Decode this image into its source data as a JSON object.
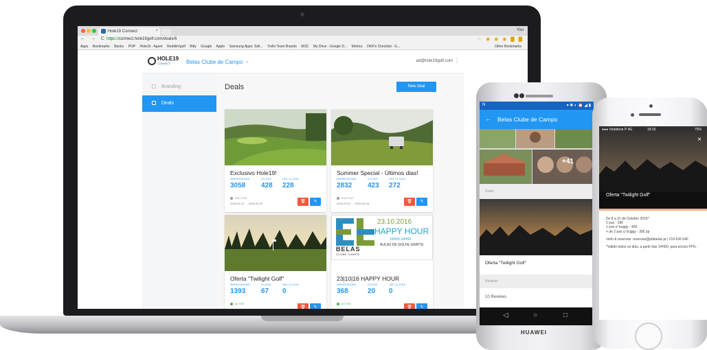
{
  "browser": {
    "tab_title": "Hole19 Connect",
    "tab_close": "×",
    "profile": "You",
    "url_scheme": "https://",
    "url_host": "connect.hole19golf.com/deals/6",
    "bookmarks": [
      "Apps",
      "Bookmarks",
      "Banks",
      "POP",
      "Hole19 - Agent",
      "Reddit/r/golf",
      "Bitly",
      "Google",
      "Apple",
      "Samsung Apps: Sell...",
      "Trello Team Boards",
      "MSC",
      "My Drive - Google D...",
      "Metrics",
      "DKR's Checklist - G..."
    ],
    "other_bookmarks": "Other Bookmarks"
  },
  "app": {
    "logo_name": "HOLE19",
    "logo_sub": "CONNECT",
    "club_name": "Belas Clube de Campo",
    "club_caret": "⌄",
    "user_email": "ad@hole19golf.com",
    "user_menu": "⋮",
    "sidebar": [
      {
        "label": "Branding",
        "active": false
      },
      {
        "label": "Deals",
        "active": true
      }
    ],
    "page_title": "Deals",
    "new_deal": "New deal",
    "metric_labels": {
      "impressions": "IMPRESSIONS",
      "clicks": "CLICKS",
      "url_clicks": "URL CLICKS"
    },
    "deals": [
      {
        "title": "Exclusivo Hole19!",
        "impressions": "3058",
        "clicks": "428",
        "url_clicks": "228",
        "status": "INACTIVE",
        "start": "2016-09-15",
        "end": "2016-09-20"
      },
      {
        "title": "Summer Special - Últimos dias!",
        "impressions": "2832",
        "clicks": "423",
        "url_clicks": "272",
        "status": "INACTIVE",
        "start": "2016-09-01",
        "end": "2016-09-16"
      },
      {
        "title": "Oferta \"Twilight Golf\"",
        "impressions": "1393",
        "clicks": "67",
        "url_clicks": "0",
        "status": "ACTIVE"
      },
      {
        "title": "23|10|16 HAPPY HOUR",
        "impressions": "368",
        "clicks": "20",
        "url_clicks": "0",
        "status": "ACTIVE"
      }
    ],
    "date_arrow": "→",
    "delete_icon": "🗑",
    "edit_icon": "✎",
    "promo": {
      "date": "23.10.2016",
      "headline": "HAPPY HOUR",
      "time": "15H00-18H00",
      "subtitle": "AULAS DE GOLFE GRÁTIS",
      "brand": "BELAS",
      "brand_sub": "CLUBE CAMPO"
    }
  },
  "android": {
    "status_left": "N",
    "status_right": "▾ ✱ ◐ ⏰ ◢ ▮",
    "title": "Belas Clube de Campo",
    "back": "←",
    "gallery_more": "+41",
    "deals_label": "Deals",
    "deal_title": "Oferta \"Twilight Golf\"",
    "reviews_label": "Reviews",
    "reviews_count": "10 Reviews",
    "nav_back": "◁",
    "nav_home": "○",
    "nav_recent": "□",
    "brand": "HUAWEI"
  },
  "iphone": {
    "status_left": "●●● Vodafone P  4G",
    "status_time": "18:16",
    "status_battery": "75%",
    "close": "×",
    "title": "Oferta \"Twilight Golf\"",
    "body": [
      "De 8 a 31 de Outubro 2016*\n1 pax - 28€\n1 pax c/ buggy - 45€\n+ de 2 pax c/ buggy - 35€ pp",
      "ninfo & reservas: reservas@pfabelas.pt | 219 626 640",
      "*Válido todos os dias, a partir das 14H00, para sócios FPG."
    ]
  },
  "colors": {
    "primary": "#2196f3",
    "danger": "#ef5a3c",
    "active": "#4caf50"
  }
}
